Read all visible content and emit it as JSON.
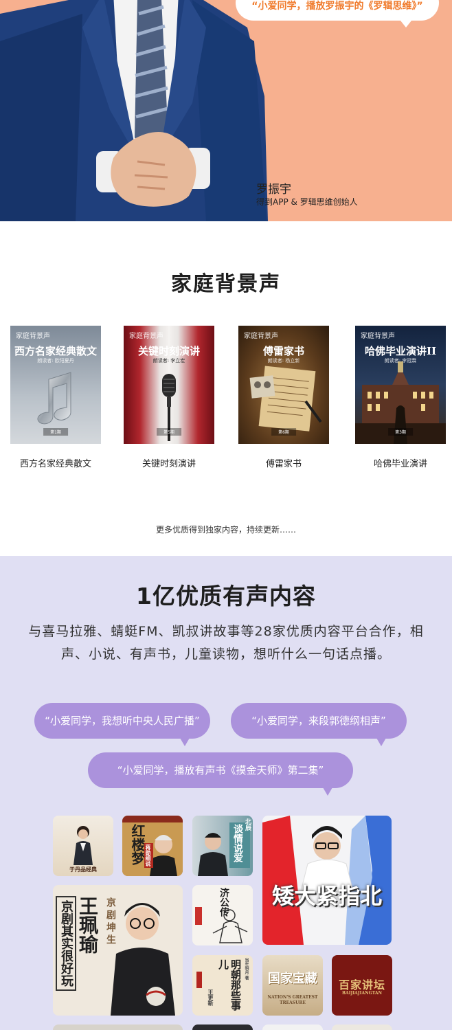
{
  "hero": {
    "bubble_text": "“小爱同学，播放罗振宇的《罗辑思维》”",
    "person_name": "罗振宇",
    "person_title": "得到APP & 罗辑思维创始人",
    "bg_color": "#f7b08f"
  },
  "family": {
    "title": "家庭背景声",
    "books": [
      {
        "cover_title": "西方名家经典散文",
        "cover_brand": "家庭背景声",
        "cover_reader": "朗读者: 欧阳夏丹",
        "cover_episode": "第1期",
        "label": "西方名家经典散文"
      },
      {
        "cover_title": "关键时刻演讲",
        "cover_brand": "家庭背景声",
        "cover_reader": "朗读者: 李立宏",
        "cover_episode": "第5期",
        "label": "关键时刻演讲"
      },
      {
        "cover_title": "傅雷家书",
        "cover_brand": "家庭背景声",
        "cover_reader": "朗读者: 杨立新",
        "cover_episode": "第6期",
        "label": "傅雷家书"
      },
      {
        "cover_title": "哈佛毕业演讲II",
        "cover_brand": "家庭背景声",
        "cover_reader": "朗读者: 李冠霖",
        "cover_episode": "第3期",
        "label": "哈佛毕业演讲"
      }
    ],
    "more_text": "更多优质得到独家内容，持续更新……"
  },
  "content": {
    "title": "1亿优质有声内容",
    "description": "与喜马拉雅、蜻蜓FM、凯叔讲故事等28家优质内容平台合作，相声、小说、有声书，儿童读物，想听什么一句话点播。",
    "bubbles": [
      "“小爱同学，我想听中央人民广播”",
      "“小爱同学，来段郭德纲相声”",
      "“小爱同学，播放有声书《摸金天师》第二集”"
    ],
    "bubble_color": "#ab92dc",
    "bg_color": "#e0dff3",
    "tiles": {
      "yudan": "于丹品经典",
      "hongloumeng": "红楼梦",
      "hongloumeng_badge": "蒋勋细说",
      "tanqing": "谈情说爱",
      "tanqing_sub": "北辰",
      "gaoxiaosong": "矮大紧指北",
      "wangpeiyu_name": "王珮瑜",
      "wangpeiyu_tag": "京剧坤生",
      "wangpeiyu_slogan": "京剧其实很好玩",
      "jigong": "济公传",
      "mingchao": "明朝那些事儿",
      "mingchao_author": "当年明月 著",
      "mingchao_reader": "王更新",
      "guobao": "国家宝藏",
      "guobao_en": "NATION'S GREATEST TREASURE",
      "baijia": "百家讲坛",
      "baijia_pinyin": "BAIJIAJIANGTAN"
    }
  }
}
